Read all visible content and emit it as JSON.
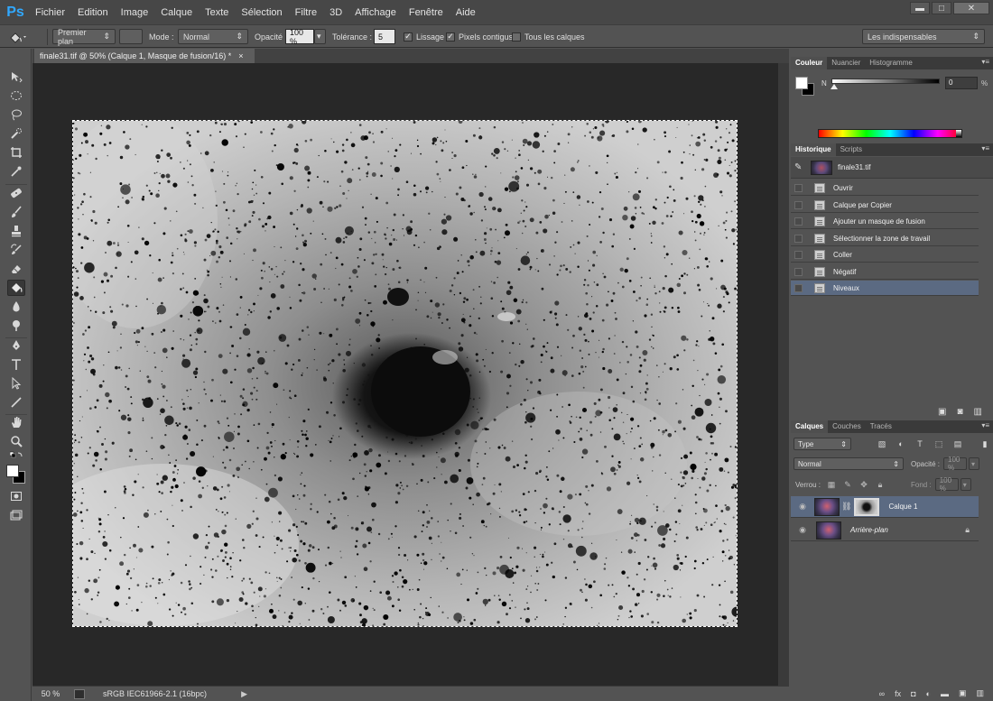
{
  "app": {
    "logo": "Ps"
  },
  "menu": [
    "Fichier",
    "Edition",
    "Image",
    "Calque",
    "Texte",
    "Sélection",
    "Filtre",
    "3D",
    "Affichage",
    "Fenêtre",
    "Aide"
  ],
  "window_controls": {
    "minimize": "▬",
    "maximize": "□",
    "close": "✕"
  },
  "options": {
    "preset": "Premier plan",
    "mode_label": "Mode :",
    "mode_value": "Normal",
    "opacity_label": "Opacité :",
    "opacity_value": "100 %",
    "tolerance_label": "Tolérance :",
    "tolerance_value": "5",
    "lissage_label": "Lissage",
    "lissage_checked": true,
    "contigus_label": "Pixels contigus",
    "contigus_checked": true,
    "tous_calques_label": "Tous les calques",
    "tous_calques_checked": false,
    "workspace": "Les indispensables"
  },
  "document": {
    "tab_title": "finale31.tif @ 50% (Calque 1, Masque de fusion/16) *",
    "tab_close": "×",
    "zoom": "50 %",
    "profile": "sRGB IEC61966-2.1 (16bpc)"
  },
  "color_panel": {
    "tabs": [
      "Couleur",
      "Nuancier",
      "Histogramme"
    ],
    "channel_label": "N",
    "value": "0",
    "unit": "%",
    "level": 0
  },
  "history_panel": {
    "tabs": [
      "Historique",
      "Scripts"
    ],
    "snapshot": "finale31.tif",
    "states": [
      "Ouvrir",
      "Calque par Copier",
      "Ajouter un masque de fusion",
      "Sélectionner la zone de travail",
      "Coller",
      "Négatif",
      "Niveaux"
    ],
    "selected_index": 6
  },
  "layers_panel": {
    "tabs": [
      "Calques",
      "Couches",
      "Tracés"
    ],
    "filter_kind": "Type",
    "blend_mode": "Normal",
    "opacity_label": "Opacité :",
    "opacity_value": "100 %",
    "lock_label": "Verrou :",
    "fill_label": "Fond :",
    "fill_value": "100 %",
    "layers": [
      {
        "name": "Calque 1",
        "selected": true,
        "has_mask": true,
        "locked": false
      },
      {
        "name": "Arrière-plan",
        "selected": false,
        "has_mask": false,
        "locked": true
      }
    ]
  },
  "colors": {
    "app_bg": "#535353",
    "canvas_frame": "#282828",
    "selection": "#5b6a82",
    "accent": "#31a8ff"
  }
}
